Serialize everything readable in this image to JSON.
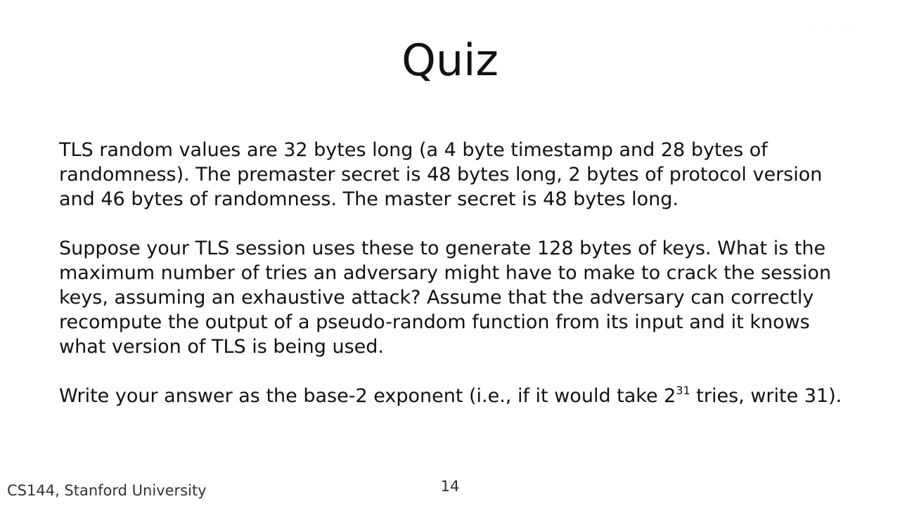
{
  "slide": {
    "title": "Quiz",
    "paragraph1": "TLS random values are 32 bytes long (a 4 byte timestamp and 28 bytes of randomness). The premaster secret is 48 bytes long, 2 bytes of protocol version and 46 bytes of randomness. The master secret is 48 bytes long.",
    "paragraph2": "Suppose your TLS session uses these to generate 128 bytes of keys. What is the maximum number of tries an adversary might have to make to crack the session keys, assuming an exhaustive attack? Assume that the adversary can correctly recompute the output of a pseudo-random function from its input and it knows what version of TLS is being used.",
    "paragraph3": {
      "before": "Write your answer as the base-2 exponent (i.e., if it would take 2",
      "exponent": "31",
      "after": " tries, write 31)."
    }
  },
  "footer": {
    "course": "CS144, Stanford University",
    "page_number": "14"
  }
}
